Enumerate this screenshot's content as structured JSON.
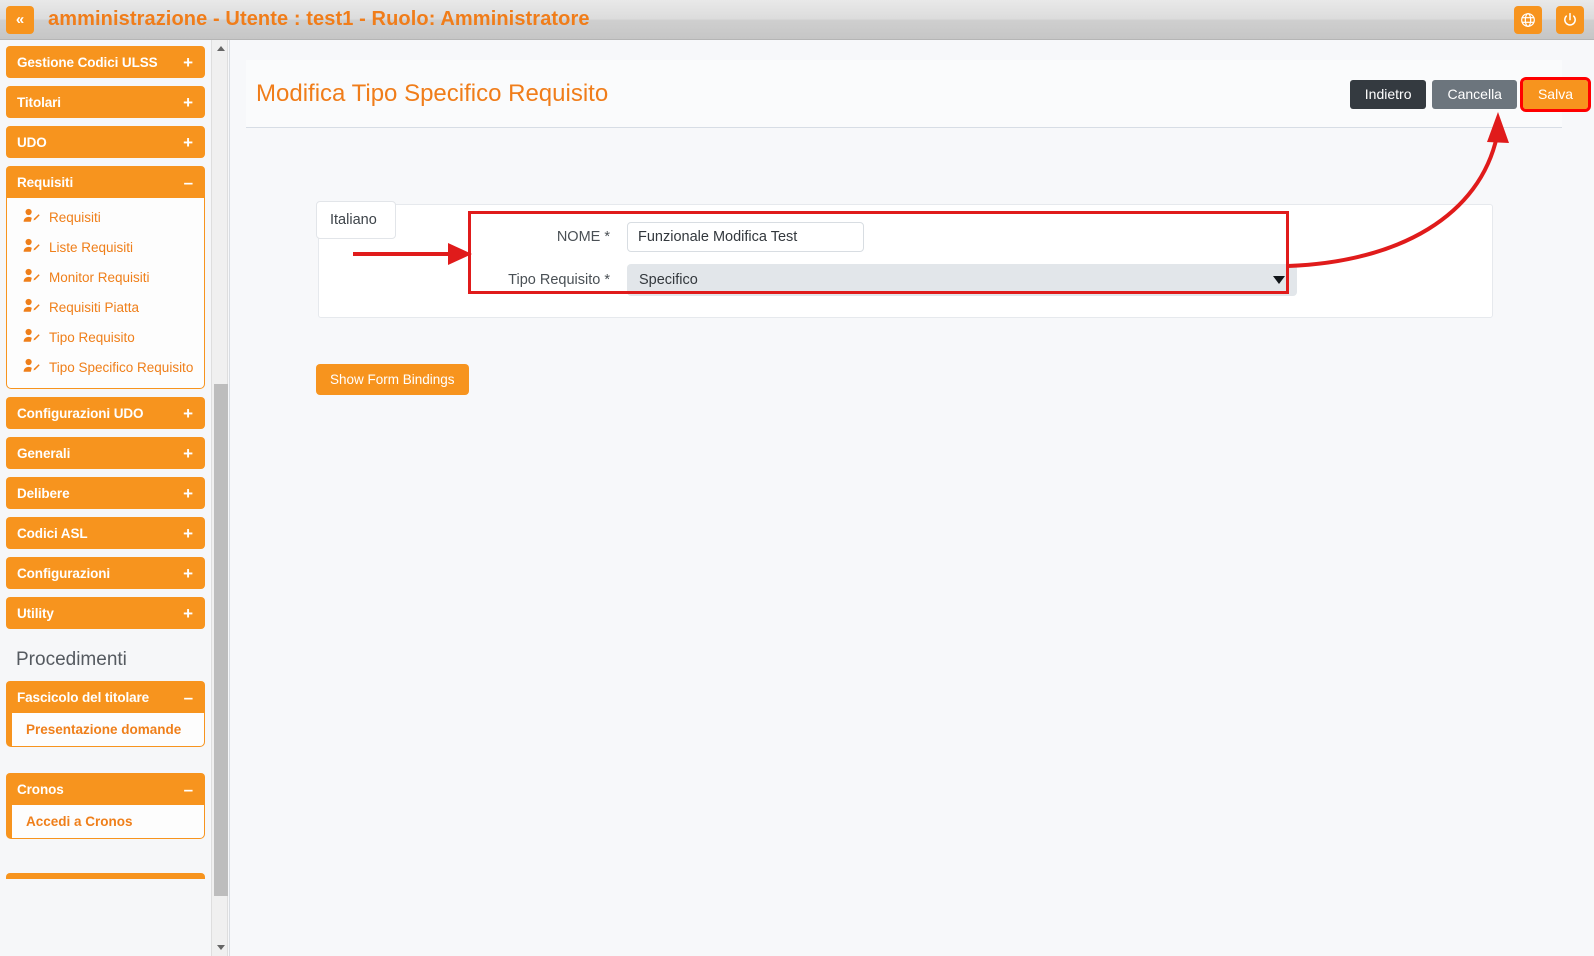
{
  "topbar": {
    "collapse_icon": "double-chevron-left-icon",
    "title": "amministrazione - Utente : test1 - Ruolo: Amministratore",
    "language_icon": "globe-icon",
    "logout_icon": "power-icon"
  },
  "sidebar": {
    "groups": [
      {
        "label": "Gestione Codici ULSS",
        "toggle": "+",
        "expanded": false
      },
      {
        "label": "Titolari",
        "toggle": "+",
        "expanded": false
      },
      {
        "label": "UDO",
        "toggle": "+",
        "expanded": false
      },
      {
        "label": "Requisiti",
        "toggle": "–",
        "expanded": true,
        "items": [
          {
            "label": "Requisiti",
            "icon": "user-edit-icon"
          },
          {
            "label": "Liste Requisiti",
            "icon": "user-edit-icon"
          },
          {
            "label": "Monitor Requisiti",
            "icon": "user-edit-icon"
          },
          {
            "label": "Requisiti Piatta",
            "icon": "user-edit-icon"
          },
          {
            "label": "Tipo Requisito",
            "icon": "user-edit-icon"
          },
          {
            "label": "Tipo Specifico Requisito",
            "icon": "user-edit-icon"
          }
        ]
      },
      {
        "label": "Configurazioni UDO",
        "toggle": "+",
        "expanded": false
      },
      {
        "label": "Generali",
        "toggle": "+",
        "expanded": false
      },
      {
        "label": "Delibere",
        "toggle": "+",
        "expanded": false
      },
      {
        "label": "Codici ASL",
        "toggle": "+",
        "expanded": false
      },
      {
        "label": "Configurazioni",
        "toggle": "+",
        "expanded": false
      },
      {
        "label": "Utility",
        "toggle": "+",
        "expanded": false
      }
    ],
    "section_title": "Procedimenti",
    "procedimenti": [
      {
        "label": "Fascicolo del titolare",
        "toggle": "–",
        "items": [
          {
            "label": "Presentazione domande"
          }
        ]
      },
      {
        "label": "Cronos",
        "toggle": "–",
        "items": [
          {
            "label": "Accedi a Cronos"
          }
        ]
      }
    ],
    "scrollbar": {
      "up_icon": "caret-up-icon",
      "down_icon": "caret-down-icon"
    }
  },
  "page": {
    "title": "Modifica Tipo Specifico Requisito",
    "buttons": {
      "back": "Indietro",
      "cancel": "Cancella",
      "save": "Salva"
    },
    "tab": "Italiano",
    "form": {
      "nome_label": "NOME *",
      "nome_value": "Funzionale Modifica Test",
      "nome_placeholder": "",
      "tipo_label": "Tipo Requisito *",
      "tipo_value": "Specifico",
      "tipo_caret_icon": "caret-down-icon"
    },
    "show_bindings_button": "Show Form Bindings"
  },
  "colors": {
    "brand_orange": "#f7941e",
    "title_orange": "#f07d1a",
    "annotation_red": "#e01b1b",
    "dark_button": "#343a40",
    "grey_button": "#6c757d"
  }
}
